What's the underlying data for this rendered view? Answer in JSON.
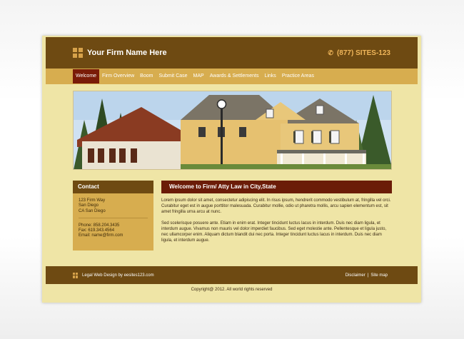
{
  "header": {
    "firm_name": "Your Firm Name Here",
    "phone": "(877) SITES-123"
  },
  "nav": {
    "items": [
      {
        "label": "Welcome"
      },
      {
        "label": "Firm Overview"
      },
      {
        "label": "Boom"
      },
      {
        "label": "Submit Case"
      },
      {
        "label": "MAP"
      },
      {
        "label": "Awards & Settlements"
      },
      {
        "label": "Links"
      },
      {
        "label": "Practice Areas"
      }
    ],
    "active": "Welcome"
  },
  "contact": {
    "heading": "Contact",
    "address_line1": "123 Firm Way",
    "address_line2": "San Diego",
    "address_line3": "CA San Diego",
    "phone": "Phone: 858.204.3435",
    "fax": "Fax: 619.343.4564",
    "email": "Email: name@firm.com"
  },
  "welcome": {
    "heading": "Welcome to Firm/ Atty Law in City,State",
    "paragraph1": "Lorem ipsum dolor sit amet, consectetur adipiscing elit. In risus ipsum, hendrerit commodo vestibulum at, fringilla vel orci. Curabitur eget est in augue porttitor malesuada. Curabitur mollie, odio ut pharetra mollis, arcu sapien elementum est, sit amet fringilla urna arcu at nunc.",
    "paragraph2": "Sed scelerisque posuere ante. Etiam in enim erat. Integer tincidunt luctus lacus in interdum. Duis nec diam ligula, et interdum augue. Vivamus non mauris vel dolor imperdiet faucibus. Sed eget molestie ante. Pellentesque et ligula justo, nec ullamcorper enim. Aliquam dictum blandit dui nec porta. Integer tincidunt luctus lacus in interdum. Duis nec diam ligula, et interdum augue."
  },
  "footer": {
    "credit": "Legal Web Design by eesites123.com",
    "disclaimer": "Disclaimer",
    "separator": "|",
    "sitemap": "Site map"
  },
  "copyright": "Copyright@ 2012. All world rights reserved"
}
